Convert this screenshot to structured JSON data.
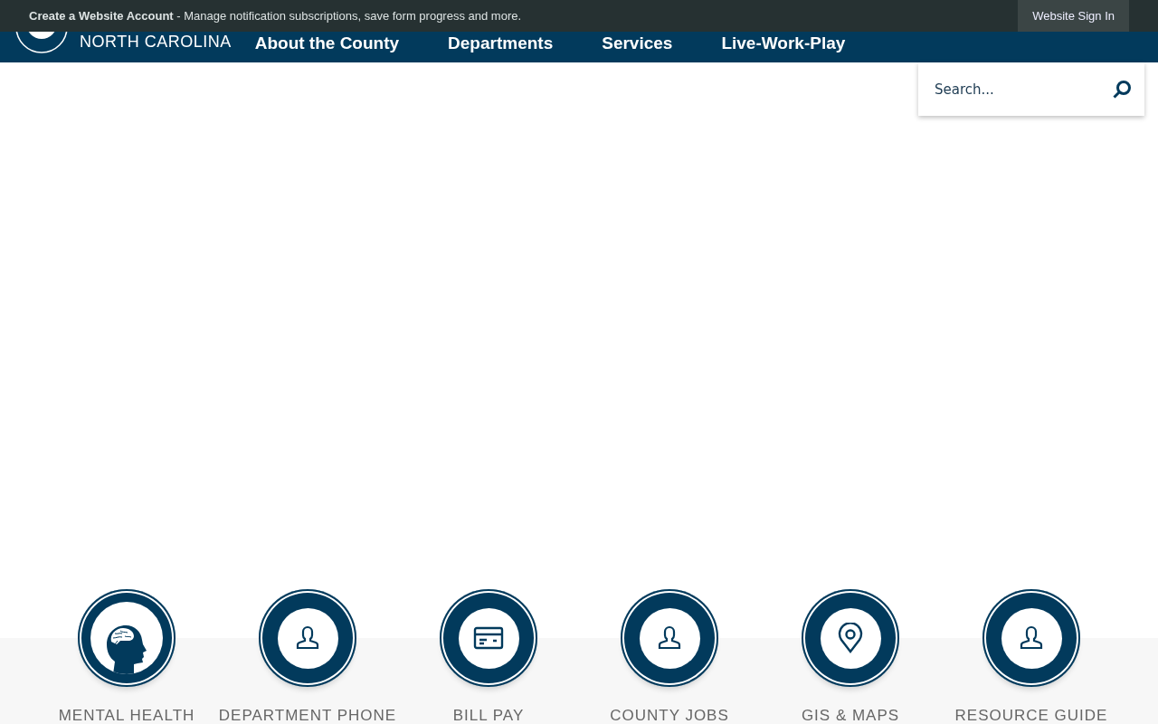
{
  "top_bar": {
    "message_bold": "Create a Website Account",
    "message": " - Manage notification subscriptions, save form progress and more.",
    "sign_in": "Website Sign In"
  },
  "logo": {
    "state": "NORTH CAROLINA"
  },
  "nav": [
    "About the County",
    "Departments",
    "Services",
    "Live-Work-Play"
  ],
  "search": {
    "placeholder": "Search..."
  },
  "quick_links": [
    {
      "kind": "brain",
      "label": "MENTAL HEALTH"
    },
    {
      "kind": "person",
      "label": "DEPARTMENT PHONE"
    },
    {
      "kind": "card",
      "label": "BILL PAY"
    },
    {
      "kind": "person",
      "label": "COUNTY JOBS"
    },
    {
      "kind": "pin",
      "label": "GIS & MAPS"
    },
    {
      "kind": "person",
      "label": "RESOURCE GUIDE"
    }
  ]
}
